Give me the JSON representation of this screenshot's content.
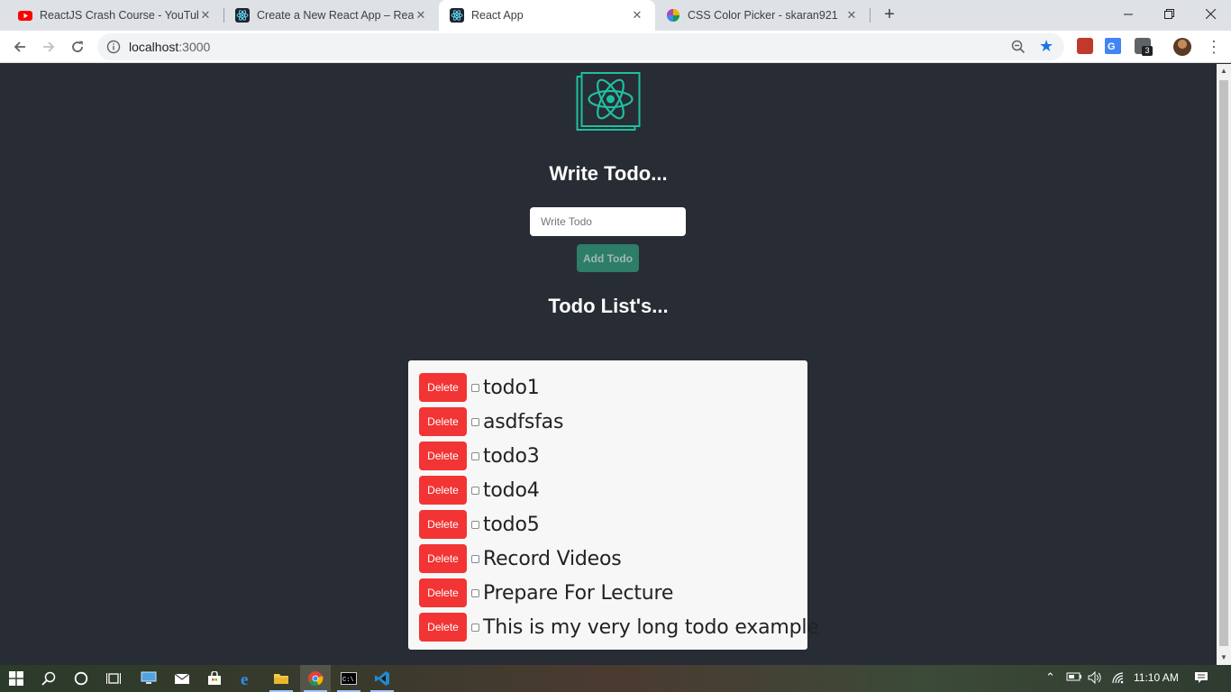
{
  "browser": {
    "tabs": [
      {
        "title": "ReactJS Crash Course - YouTube",
        "icon": "youtube-icon",
        "active": false
      },
      {
        "title": "Create a New React App – React",
        "icon": "react-icon",
        "active": false
      },
      {
        "title": "React App",
        "icon": "react-icon",
        "active": true
      },
      {
        "title": "CSS Color Picker - skaran921",
        "icon": "color-wheel-icon",
        "active": false
      }
    ],
    "close_glyph": "✕",
    "new_tab_glyph": "+",
    "url_host": "localhost",
    "url_port": ":3000",
    "extension_badge": "3"
  },
  "app": {
    "write_heading": "Write Todo...",
    "input_placeholder": "Write Todo",
    "input_value": "",
    "add_label": "Add Todo",
    "list_heading": "Todo List's...",
    "delete_label": "Delete",
    "todos": [
      {
        "text": "todo1",
        "done": false
      },
      {
        "text": "asdfsfas",
        "done": false
      },
      {
        "text": "todo3",
        "done": false
      },
      {
        "text": "todo4",
        "done": false
      },
      {
        "text": "todo5",
        "done": false
      },
      {
        "text": "Record Videos",
        "done": false
      },
      {
        "text": "Prepare For Lecture",
        "done": false
      },
      {
        "text": "This is my very long todo example",
        "done": false
      }
    ]
  },
  "taskbar": {
    "clock": "11:10 AM"
  },
  "colors": {
    "page_bg": "#282c34",
    "react_cyan": "#1ebfa0",
    "add_button": "#2e7d68",
    "delete_button": "#f23434"
  }
}
